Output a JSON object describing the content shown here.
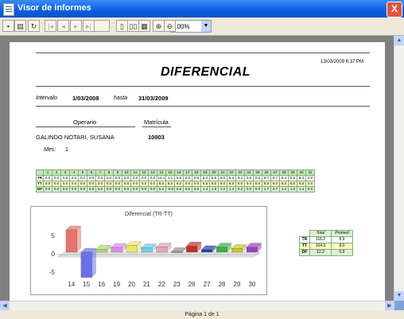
{
  "window": {
    "title": "Visor de informes",
    "close_glyph": "X"
  },
  "toolbar": {
    "zoom_value": "100%"
  },
  "report": {
    "timestamp": "13/03/2009 6:37 PM",
    "title": "DIFERENCIAL",
    "interval_label": "Intervalo",
    "interval_from": "1/03/2008",
    "until_label": "hasta",
    "interval_to": "31/03/2009",
    "operator_header": "Operario",
    "matricula_header": "Matrícula",
    "operator_name": "GALINDO NOTARI, SUSANA",
    "matricula_value": "10003",
    "month_label": "Mes:",
    "month_value": "1"
  },
  "daily_table": {
    "days": [
      "1",
      "2",
      "3",
      "4",
      "5",
      "6",
      "7",
      "8",
      "9",
      "10",
      "11",
      "12",
      "13",
      "14",
      "15",
      "16",
      "17",
      "18",
      "19",
      "20",
      "21",
      "22",
      "23",
      "24",
      "25",
      "26",
      "27",
      "28",
      "29",
      "30",
      "31"
    ],
    "rows": [
      {
        "label": "TR",
        "values": [
          "0.0",
          "0.0",
          "0.0",
          "0.0",
          "0.0",
          "0.0",
          "0.0",
          "0.0",
          "0.0",
          "0.0",
          "0.0",
          "0.0",
          "0.0",
          "14.1",
          "1.1",
          "8.8",
          "0.0",
          "0.0",
          "8.3",
          "8.8",
          "8.0",
          "8.4",
          "8.2",
          "0.0",
          "0.0",
          "8.7",
          "8.7",
          "8.4",
          "8.0",
          "8.4",
          "0.0"
        ]
      },
      {
        "label": "TT",
        "values": [
          "0.0",
          "0.0",
          "0.0",
          "0.0",
          "0.0",
          "0.0",
          "0.0",
          "0.0",
          "0.0",
          "0.0",
          "0.0",
          "0.0",
          "0.0",
          "8.0",
          "8.0",
          "8.0",
          "0.0",
          "0.0",
          "8.0",
          "8.0",
          "8.0",
          "8.0",
          "8.0",
          "0.0",
          "0.0",
          "8.0",
          "8.0",
          "8.0",
          "8.0",
          "8.0",
          "0.0"
        ]
      },
      {
        "label": "DF",
        "values": [
          "0.0",
          "0.0",
          "0.0",
          "0.0",
          "0.0",
          "0.0",
          "0.0",
          "0.0",
          "0.0",
          "0.0",
          "0.0",
          "0.0",
          "0.0",
          "6.1",
          "-6.9",
          "0.8",
          "0.0",
          "0.0",
          "1.3",
          "1.8",
          "1.2",
          "1.4",
          "0.2",
          "0.0",
          "0.0",
          "1.7",
          "0.7",
          "1.4",
          "1.0",
          "1.4",
          "0.0"
        ]
      }
    ]
  },
  "totals_table": {
    "headers": [
      "Total",
      "Promed"
    ],
    "rows": [
      {
        "label": "TR",
        "total": "116.2",
        "prom": "8.9"
      },
      {
        "label": "TT",
        "total": "104.0",
        "prom": "8.0"
      },
      {
        "label": "DF",
        "total": "12.2",
        "prom": "0.9"
      }
    ]
  },
  "chart_data": {
    "type": "bar",
    "title": "Diferencial (TR-TT)",
    "categories": [
      "14",
      "15",
      "16",
      "19",
      "20",
      "21",
      "22",
      "23",
      "26",
      "27",
      "28",
      "29",
      "30"
    ],
    "values": [
      6.1,
      -6.9,
      0.8,
      1.3,
      1.8,
      1.2,
      1.4,
      0.2,
      1.7,
      0.7,
      1.4,
      1.0,
      1.4
    ],
    "colors": [
      "#e8736c",
      "#6a71e6",
      "#a8d870",
      "#d98ee8",
      "#e6e66a",
      "#6ad0e6",
      "#e6a6b0",
      "#8f8f8f",
      "#c0302a",
      "#2a3aa8",
      "#3fae3f",
      "#c8c830",
      "#9b3fc0"
    ],
    "ylim": [
      -7,
      7
    ],
    "yticks": [
      "5",
      "0",
      "-5"
    ],
    "xlabel": "",
    "ylabel": ""
  },
  "status": {
    "page_text": "Página 1 de 1"
  }
}
